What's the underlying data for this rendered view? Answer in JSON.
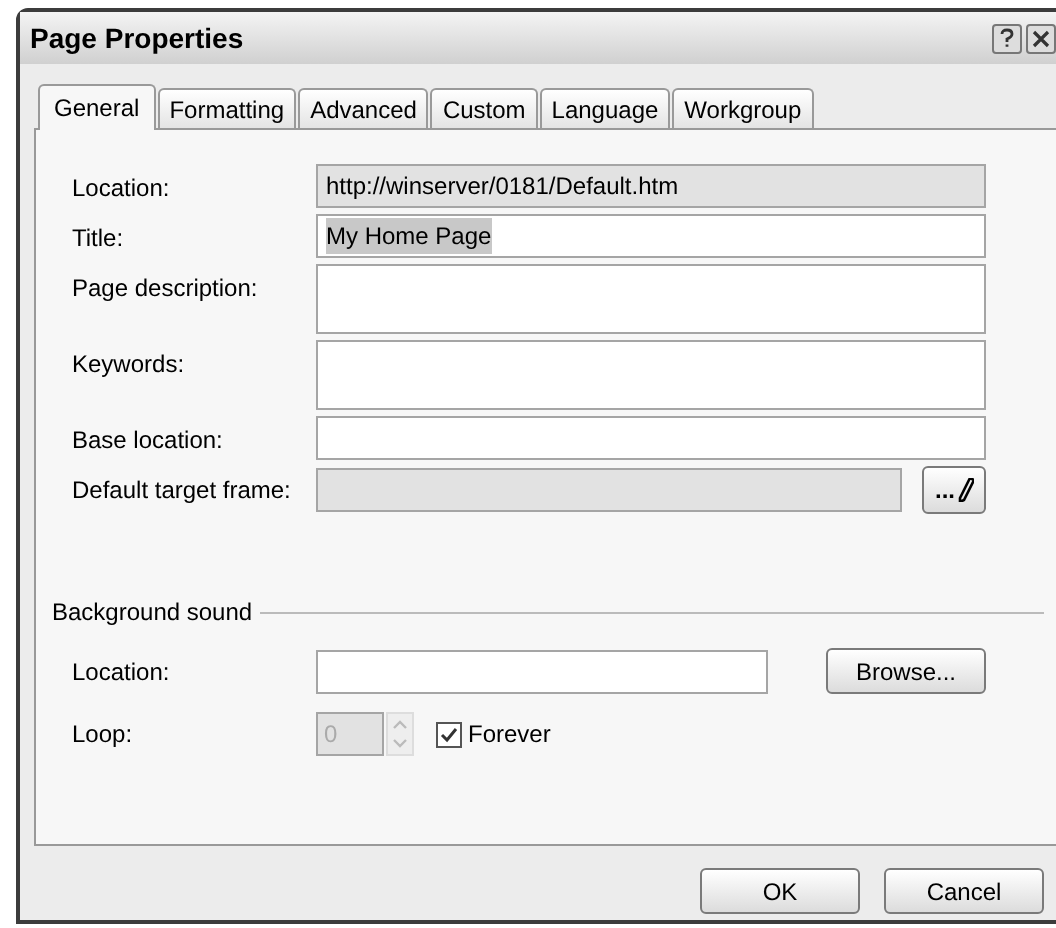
{
  "window": {
    "title": "Page Properties"
  },
  "tabs": [
    {
      "label": "General",
      "selected": true
    },
    {
      "label": "Formatting",
      "selected": false
    },
    {
      "label": "Advanced",
      "selected": false
    },
    {
      "label": "Custom",
      "selected": false
    },
    {
      "label": "Language",
      "selected": false
    },
    {
      "label": "Workgroup",
      "selected": false
    }
  ],
  "fields": [
    {
      "kind": "text",
      "label": "Location:",
      "value": "http://winserver/0181/Default.htm",
      "disabled": true
    },
    {
      "kind": "text",
      "label": "Title:",
      "value": "My Home Page",
      "disabled": false
    },
    {
      "kind": "area",
      "label": "Page description:",
      "disabled": false
    },
    {
      "kind": "area",
      "label": "Keywords:",
      "disabled": false
    },
    {
      "kind": "text",
      "label": "Base location:",
      "disabled": false
    },
    {
      "kind": "picker",
      "label": "Default target frame:",
      "disabled": true,
      "button": "..."
    }
  ],
  "background_sound": {
    "heading": "Background sound",
    "location_label": "Location:",
    "browse": "Browse...",
    "loop_label": "Loop:",
    "loop_value": "0",
    "loop_disabled": true,
    "forever": {
      "label": "Forever",
      "checked": true
    }
  },
  "buttons": [
    "OK",
    "Cancel"
  ]
}
